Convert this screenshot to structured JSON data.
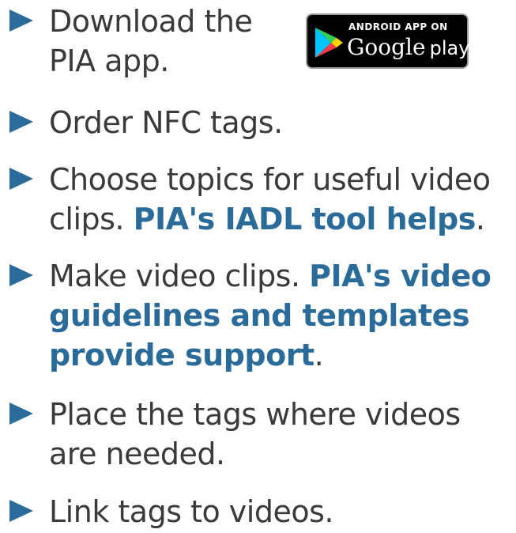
{
  "items": [
    {
      "text": "Download the\nPIA app."
    },
    {
      "text": "Order NFC tags."
    },
    {
      "pre": "Choose topics for useful video\nclips. ",
      "link": "PIA's IADL tool helps",
      "post": "."
    },
    {
      "pre": "Make video clips. ",
      "link": "PIA's video\nguidelines and templates\nprovide support",
      "post": "."
    },
    {
      "text": "Place the tags where videos\nare needed."
    },
    {
      "text": "Link tags to videos."
    }
  ],
  "badge": {
    "top_text": "ANDROID APP ON",
    "brand": "Google",
    "product": "play",
    "icon": "google-play-icon"
  },
  "colors": {
    "bullet": "#2a6b9a",
    "link": "#2a6b9a",
    "text": "#3a3a3a"
  }
}
